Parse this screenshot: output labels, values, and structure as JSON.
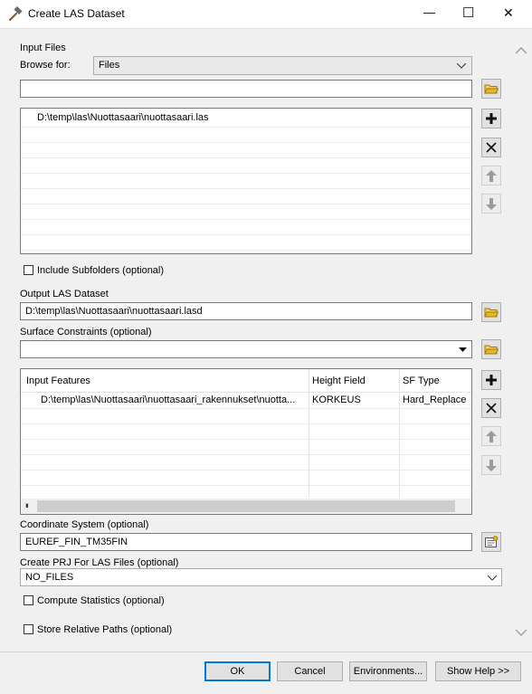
{
  "window": {
    "title": "Create LAS Dataset",
    "minimize_glyph": "—",
    "maximize_glyph": "☐",
    "close_glyph": "✕"
  },
  "input_files": {
    "section_label": "Input Files",
    "browse_label": "Browse for:",
    "browse_value": "Files",
    "path_value": "",
    "items": [
      "D:\\temp\\las\\Nuottasaari\\nuottasaari.las"
    ]
  },
  "include_subfolders": {
    "label": "Include Subfolders (optional)",
    "checked": false
  },
  "output": {
    "label": "Output LAS Dataset",
    "value": "D:\\temp\\las\\Nuottasaari\\nuottasaari.lasd"
  },
  "surface_constraints": {
    "label": "Surface Constraints (optional)",
    "value": "",
    "columns": [
      "Input Features",
      "Height Field",
      "SF Type"
    ],
    "rows": [
      [
        "D:\\temp\\las\\Nuottasaari\\nuottasaari_rakennukset\\nuotta...",
        "KORKEUS",
        "Hard_Replace"
      ]
    ]
  },
  "coordinate_system": {
    "label": "Coordinate System (optional)",
    "value": "EUREF_FIN_TM35FIN"
  },
  "create_prj": {
    "label": "Create PRJ For LAS Files (optional)",
    "value": "NO_FILES"
  },
  "compute_statistics": {
    "label": "Compute Statistics (optional)",
    "checked": false
  },
  "store_relative_paths": {
    "label": "Store Relative Paths (optional)",
    "checked": false
  },
  "buttons": {
    "ok": "OK",
    "cancel": "Cancel",
    "environments": "Environments...",
    "show_help": "Show Help >>"
  },
  "colors": {
    "accent": "#0078d7",
    "add_icon": "#222222",
    "folder_icon": "#e8b923"
  }
}
